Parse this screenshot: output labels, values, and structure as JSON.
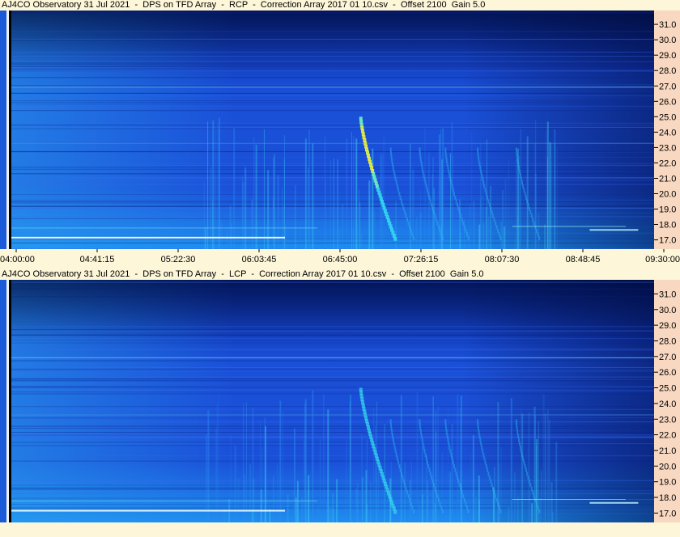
{
  "chart_data": [
    {
      "type": "heatmap",
      "title": "AJ4CO Observatory 31 Jul 2021  -  DPS on TFD Array  -  RCP  -  Correction Array 2017 01 10.csv  -  Offset 2100  Gain 5.0",
      "polarization": "RCP",
      "y_ticks": [
        "31.0",
        "30.0",
        "29.0",
        "28.0",
        "27.0",
        "26.0",
        "25.0",
        "24.0",
        "23.0",
        "22.0",
        "21.0",
        "20.0",
        "19.0",
        "18.0",
        "17.0"
      ],
      "ylim": [
        16.4,
        31.9
      ],
      "x_ticks": [
        "04:00:00",
        "04:41:15",
        "05:22:30",
        "06:03:45",
        "06:45:00",
        "07:26:15",
        "08:07:30",
        "08:48:45",
        "09:30:00"
      ],
      "colormap": [
        "#00104a",
        "#0a2aa0",
        "#1a50d8",
        "#1e8ef0",
        "#33d8f0",
        "#e8f040"
      ],
      "burst": {
        "time": "06:45:00",
        "freq_range": [
          17.0,
          25.0
        ],
        "intensity": "strong"
      }
    },
    {
      "type": "heatmap",
      "title": "AJ4CO Observatory 31 Jul 2021  -  DPS on TFD Array  -  LCP  -  Correction Array 2017 01 10.csv  -  Offset 2100  Gain 5.0",
      "polarization": "LCP",
      "y_ticks": [
        "31.0",
        "30.0",
        "29.0",
        "28.0",
        "27.0",
        "26.0",
        "25.0",
        "24.0",
        "23.0",
        "22.0",
        "21.0",
        "20.0",
        "19.0",
        "18.0",
        "17.0"
      ],
      "ylim": [
        16.4,
        31.9
      ],
      "x_ticks": [],
      "colormap": [
        "#00104a",
        "#0a2aa0",
        "#1a50d8",
        "#1e8ef0",
        "#33d8f0",
        "#e8f040"
      ],
      "burst": {
        "time": "06:45:00",
        "freq_range": [
          17.0,
          25.0
        ],
        "intensity": "moderate"
      }
    }
  ]
}
